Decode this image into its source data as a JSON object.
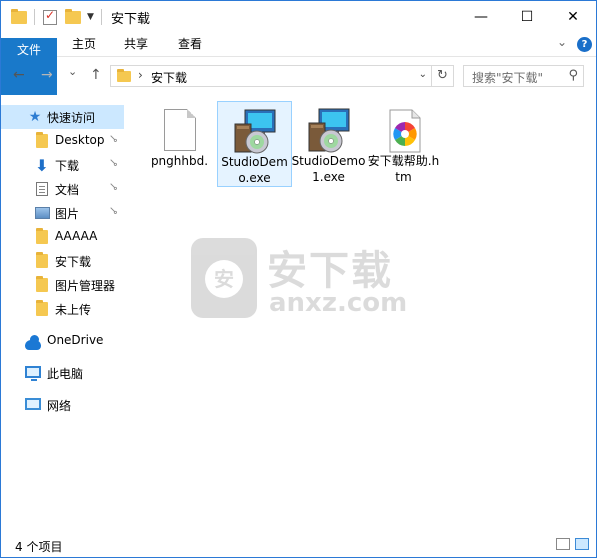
{
  "window": {
    "title": "安下载",
    "controls": {
      "minimize": "—",
      "maximize": "☐",
      "close": "✕"
    }
  },
  "ribbon": {
    "tabs": [
      {
        "label": "文件"
      },
      {
        "label": "主页"
      },
      {
        "label": "共享"
      },
      {
        "label": "查看"
      }
    ],
    "expand_glyph": "⌄",
    "help_glyph": "?"
  },
  "navigation": {
    "back_glyph": "←",
    "forward_glyph": "→",
    "recent_glyph": "⌄",
    "up_glyph": "↑",
    "address_path": "安下载",
    "address_chevron": "›",
    "refresh_glyph": "↻",
    "search_placeholder": "搜索\"安下载\"",
    "search_glyph": "⚲"
  },
  "sidebar": {
    "items": [
      {
        "label": "快速访问",
        "icon": "star-icon"
      },
      {
        "label": "Desktop",
        "icon": "folder-icon",
        "pinned": true
      },
      {
        "label": "下载",
        "icon": "download-icon",
        "pinned": true
      },
      {
        "label": "文档",
        "icon": "document-icon",
        "pinned": true
      },
      {
        "label": "图片",
        "icon": "picture-icon",
        "pinned": true
      },
      {
        "label": "AAAAA",
        "icon": "folder-icon"
      },
      {
        "label": "安下载",
        "icon": "folder-icon"
      },
      {
        "label": "图片管理器",
        "icon": "folder-icon"
      },
      {
        "label": "未上传",
        "icon": "folder-icon"
      },
      {
        "label": "OneDrive",
        "icon": "cloud-icon"
      },
      {
        "label": "此电脑",
        "icon": "computer-icon"
      },
      {
        "label": "网络",
        "icon": "network-icon"
      }
    ],
    "pin_glyph": "📌"
  },
  "files": [
    {
      "name": "pnghhbd.",
      "icon": "blank-file-icon"
    },
    {
      "name": "StudioDemo.exe",
      "icon": "installer-icon"
    },
    {
      "name": "StudioDemo1.exe",
      "icon": "installer-icon"
    },
    {
      "name": "安下载帮助.htm",
      "icon": "html-file-icon"
    }
  ],
  "watermark": {
    "logo_char": "安",
    "title": "安下载",
    "domain": "anxz.com"
  },
  "status": {
    "item_count": "4 个项目"
  },
  "colors": {
    "accent": "#1979ca",
    "selection": "#cce8ff",
    "folder": "#f5c851"
  }
}
